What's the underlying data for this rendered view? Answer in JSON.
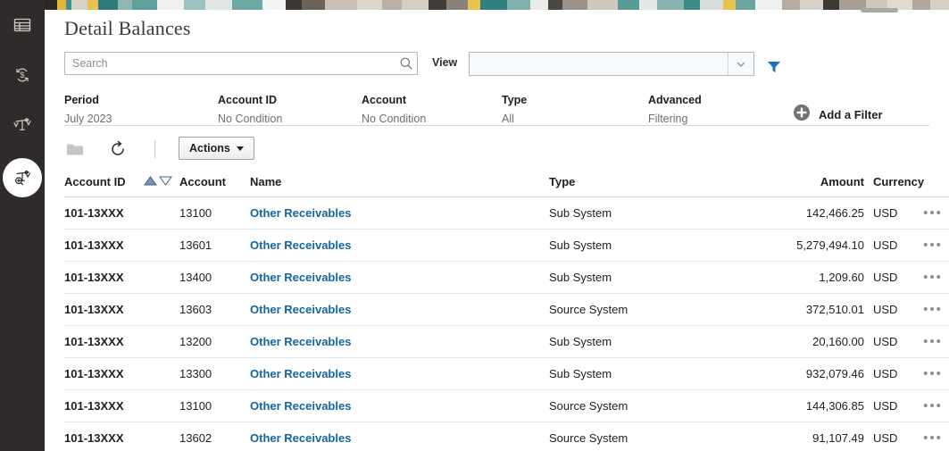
{
  "sidebar": {
    "items": [
      {
        "name": "journals-icon",
        "label": "Journals",
        "active": false
      },
      {
        "name": "currency-exchange-icon",
        "label": "Currency Rates",
        "active": false
      },
      {
        "name": "balance-scale-icon",
        "label": "Trial Balance",
        "active": false
      },
      {
        "name": "inquire-balances-icon",
        "label": "Inquire Balances",
        "active": true
      }
    ]
  },
  "header": {
    "title": "Detail Balances"
  },
  "search": {
    "placeholder": "Search",
    "value": ""
  },
  "view": {
    "label": "View",
    "value": "",
    "filter_icon": "funnel-icon",
    "accent": "#1a73c8"
  },
  "filter_bar": {
    "filters": [
      {
        "title": "Period",
        "value": "July 2023"
      },
      {
        "title": "Account ID",
        "value": "No Condition"
      },
      {
        "title": "Account",
        "value": "No Condition"
      },
      {
        "title": "Type",
        "value": "All"
      },
      {
        "title": "Advanced",
        "value": "Filtering"
      }
    ],
    "add_filter_label": "Add a Filter",
    "add_filter_icon": "circle-plus-icon"
  },
  "toolbar": {
    "folder_icon": "folder-icon",
    "refresh_icon": "refresh-icon",
    "actions_label": "Actions"
  },
  "table": {
    "columns": [
      {
        "key": "account_id",
        "label": "Account ID",
        "sortable": true,
        "sort": "asc"
      },
      {
        "key": "account",
        "label": "Account"
      },
      {
        "key": "name",
        "label": "Name"
      },
      {
        "key": "type",
        "label": "Type"
      },
      {
        "key": "amount",
        "label": "Amount"
      },
      {
        "key": "currency",
        "label": "Currency"
      }
    ],
    "row_menu_icon": "overflow-menu-icon",
    "rows": [
      {
        "account_id": "101-13XXX",
        "account": "13100",
        "name": "Other Receivables",
        "type": "Sub System",
        "amount": "142,466.25",
        "currency": "USD"
      },
      {
        "account_id": "101-13XXX",
        "account": "13601",
        "name": "Other Receivables",
        "type": "Sub System",
        "amount": "5,279,494.10",
        "currency": "USD"
      },
      {
        "account_id": "101-13XXX",
        "account": "13400",
        "name": "Other Receivables",
        "type": "Sub System",
        "amount": "1,209.60",
        "currency": "USD"
      },
      {
        "account_id": "101-13XXX",
        "account": "13603",
        "name": "Other Receivables",
        "type": "Source System",
        "amount": "372,510.01",
        "currency": "USD"
      },
      {
        "account_id": "101-13XXX",
        "account": "13200",
        "name": "Other Receivables",
        "type": "Sub System",
        "amount": "20,160.00",
        "currency": "USD"
      },
      {
        "account_id": "101-13XXX",
        "account": "13300",
        "name": "Other Receivables",
        "type": "Sub System",
        "amount": "932,079.46",
        "currency": "USD"
      },
      {
        "account_id": "101-13XXX",
        "account": "13100",
        "name": "Other Receivables",
        "type": "Source System",
        "amount": "144,306.85",
        "currency": "USD"
      },
      {
        "account_id": "101-13XXX",
        "account": "13602",
        "name": "Other Receivables",
        "type": "Source System",
        "amount": "91,107.49",
        "currency": "USD"
      }
    ]
  }
}
